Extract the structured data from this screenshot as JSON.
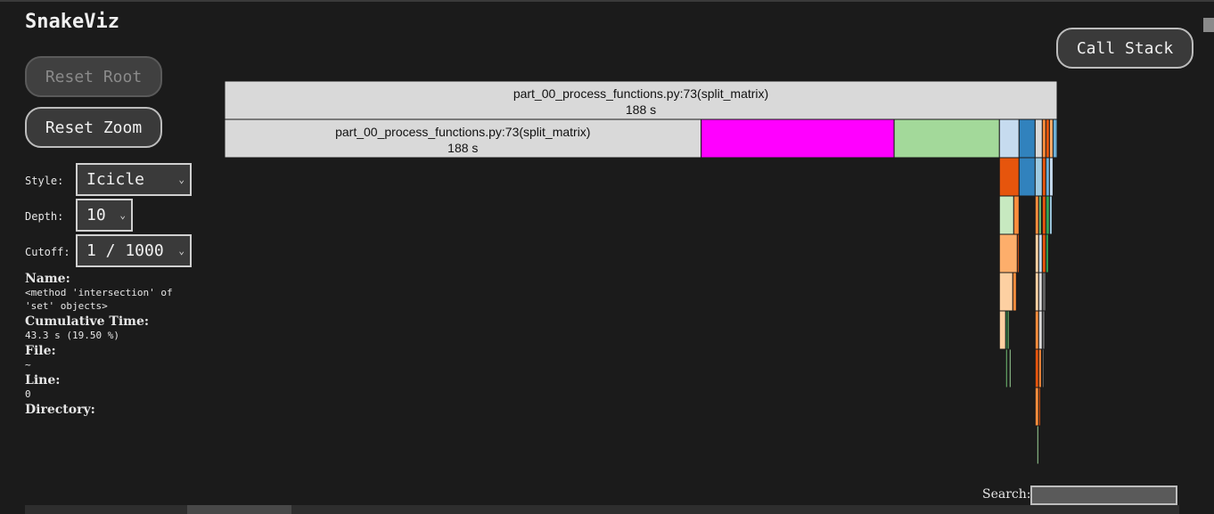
{
  "app": {
    "title": "SnakeViz"
  },
  "buttons": {
    "reset_root": "Reset Root",
    "reset_zoom": "Reset Zoom",
    "call_stack": "Call Stack"
  },
  "controls": {
    "style": {
      "label": "Style:",
      "value": "Icicle"
    },
    "depth": {
      "label": "Depth:",
      "value": "10"
    },
    "cutoff": {
      "label": "Cutoff:",
      "value": "1 / 1000"
    }
  },
  "info": {
    "name_label": "Name:",
    "name_value": "<method 'intersection' of 'set' objects>",
    "cumtime_label": "Cumulative Time:",
    "cumtime_value": "43.3 s (19.50 %)",
    "file_label": "File:",
    "file_value": "~",
    "line_label": "Line:",
    "line_value": "0",
    "directory_label": "Directory:",
    "directory_value": ""
  },
  "search": {
    "label": "Search:",
    "value": ""
  },
  "icicle": {
    "total_time_s": 188,
    "nodes": [
      {
        "name": "part_00_process_functions.py:73(split_matrix)",
        "time": "188 s",
        "depth": 0,
        "start": 0.0,
        "fraction": 1.0,
        "color": "#d9d9d9",
        "labeled": true
      },
      {
        "name": "part_00_process_functions.py:73(split_matrix)",
        "time": "188 s",
        "depth": 1,
        "start": 0.0,
        "fraction": 0.5724,
        "color": "#d9d9d9",
        "labeled": true
      },
      {
        "depth": 1,
        "start": 0.5724,
        "fraction": 0.2318,
        "color": "#ff00ff"
      },
      {
        "depth": 1,
        "start": 0.8042,
        "fraction": 0.1265,
        "color": "#a3d99a"
      },
      {
        "depth": 1,
        "start": 0.9307,
        "fraction": 0.0236,
        "color": "#c6dbef"
      },
      {
        "depth": 1,
        "start": 0.9543,
        "fraction": 0.0193,
        "color": "#3182bd"
      },
      {
        "depth": 1,
        "start": 0.9736,
        "fraction": 0.0086,
        "color": "#d9d9d9"
      },
      {
        "depth": 1,
        "start": 0.9822,
        "fraction": 0.0043,
        "color": "#fd8d3c"
      },
      {
        "depth": 1,
        "start": 0.9865,
        "fraction": 0.0043,
        "color": "#e6550d"
      },
      {
        "depth": 1,
        "start": 0.9908,
        "fraction": 0.0043,
        "color": "#fdae6b"
      },
      {
        "depth": 1,
        "start": 0.9951,
        "fraction": 0.0049,
        "color": "#6baed6"
      },
      {
        "depth": 2,
        "start": 0.9307,
        "fraction": 0.0236,
        "color": "#e6550d"
      },
      {
        "depth": 2,
        "start": 0.9543,
        "fraction": 0.0193,
        "color": "#3182bd"
      },
      {
        "depth": 2,
        "start": 0.9736,
        "fraction": 0.0086,
        "color": "#9ecae1"
      },
      {
        "depth": 2,
        "start": 0.9822,
        "fraction": 0.0043,
        "color": "#e6550d"
      },
      {
        "depth": 2,
        "start": 0.9865,
        "fraction": 0.0043,
        "color": "#6baed6"
      },
      {
        "depth": 2,
        "start": 0.9908,
        "fraction": 0.0043,
        "color": "#c6dbef"
      },
      {
        "depth": 3,
        "start": 0.9307,
        "fraction": 0.0172,
        "color": "#c7e9c0"
      },
      {
        "depth": 3,
        "start": 0.9479,
        "fraction": 0.0064,
        "color": "#fd8d3c"
      },
      {
        "depth": 3,
        "start": 0.9736,
        "fraction": 0.0043,
        "color": "#fd8d3c"
      },
      {
        "depth": 3,
        "start": 0.9779,
        "fraction": 0.0032,
        "color": "#74c476"
      },
      {
        "depth": 3,
        "start": 0.9822,
        "fraction": 0.0043,
        "color": "#e6550d"
      },
      {
        "depth": 3,
        "start": 0.9865,
        "fraction": 0.0043,
        "color": "#31a354"
      },
      {
        "depth": 3,
        "start": 0.9908,
        "fraction": 0.0032,
        "color": "#9ecae1"
      },
      {
        "depth": 4,
        "start": 0.9307,
        "fraction": 0.0215,
        "color": "#fdae6b"
      },
      {
        "depth": 4,
        "start": 0.9522,
        "fraction": 0.0021,
        "color": "#e6550d"
      },
      {
        "depth": 4,
        "start": 0.9736,
        "fraction": 0.0043,
        "color": "#fdd0a2"
      },
      {
        "depth": 4,
        "start": 0.9779,
        "fraction": 0.0043,
        "color": "#c6dbef"
      },
      {
        "depth": 4,
        "start": 0.9822,
        "fraction": 0.0043,
        "color": "#e6550d"
      },
      {
        "depth": 4,
        "start": 0.9865,
        "fraction": 0.0032,
        "color": "#31a354"
      },
      {
        "depth": 5,
        "start": 0.9307,
        "fraction": 0.0161,
        "color": "#fdd0a2"
      },
      {
        "depth": 5,
        "start": 0.9468,
        "fraction": 0.0043,
        "color": "#fd8d3c"
      },
      {
        "depth": 5,
        "start": 0.9736,
        "fraction": 0.0043,
        "color": "#fdd0a2"
      },
      {
        "depth": 5,
        "start": 0.9779,
        "fraction": 0.0043,
        "color": "#d9d9d9"
      },
      {
        "depth": 5,
        "start": 0.9822,
        "fraction": 0.0043,
        "color": "#636363"
      },
      {
        "depth": 6,
        "start": 0.9307,
        "fraction": 0.0075,
        "color": "#fdd0a2"
      },
      {
        "depth": 6,
        "start": 0.9382,
        "fraction": 0.0021,
        "color": "#31a354"
      },
      {
        "depth": 6,
        "start": 0.9403,
        "fraction": 0.0021,
        "color": "#74c476"
      },
      {
        "depth": 6,
        "start": 0.9736,
        "fraction": 0.0043,
        "color": "#fd8d3c"
      },
      {
        "depth": 6,
        "start": 0.9779,
        "fraction": 0.0043,
        "color": "#d9d9d9"
      },
      {
        "depth": 6,
        "start": 0.9822,
        "fraction": 0.0032,
        "color": "#636363"
      },
      {
        "depth": 7,
        "start": 0.9382,
        "fraction": 0.0021,
        "color": "#74c476"
      },
      {
        "depth": 7,
        "start": 0.9425,
        "fraction": 0.0021,
        "color": "#a1d99b"
      },
      {
        "depth": 7,
        "start": 0.9736,
        "fraction": 0.0043,
        "color": "#e6550d"
      },
      {
        "depth": 7,
        "start": 0.9779,
        "fraction": 0.0032,
        "color": "#fd8d3c"
      },
      {
        "depth": 7,
        "start": 0.9822,
        "fraction": 0.0021,
        "color": "#636363"
      },
      {
        "depth": 8,
        "start": 0.9736,
        "fraction": 0.0043,
        "color": "#fd8d3c"
      },
      {
        "depth": 8,
        "start": 0.9779,
        "fraction": 0.0021,
        "color": "#e6550d"
      },
      {
        "depth": 9,
        "start": 0.9757,
        "fraction": 0.0021,
        "color": "#a1d99b"
      }
    ]
  }
}
